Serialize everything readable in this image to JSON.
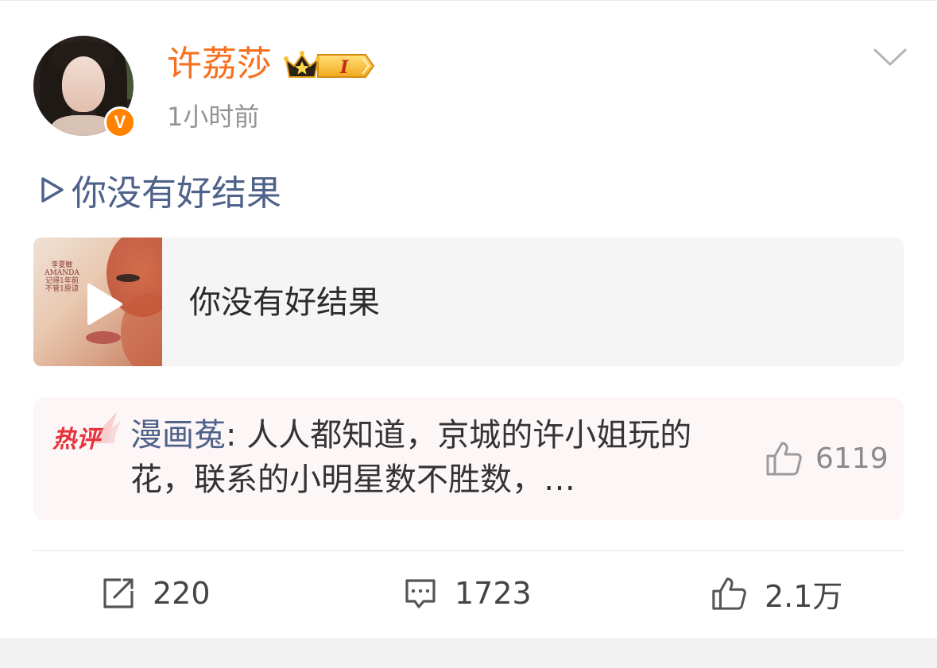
{
  "post": {
    "author": {
      "name": "许荔莎",
      "verified_badge": "V",
      "member_level": "I"
    },
    "timestamp": "1小时前",
    "body_link": "你没有好结果",
    "music_card": {
      "title": "你没有好结果",
      "cover_text": [
        "李夏敏",
        "AMANDA",
        "记得1年前",
        "不管1原谅"
      ]
    },
    "hot_comment": {
      "tag": "热评",
      "author": "漫画菟",
      "text": ": 人人都知道，京城的许小姐玩的花，联系的小明星数不胜数，…",
      "likes": "6119"
    },
    "actions": {
      "reposts": "220",
      "comments": "1723",
      "likes": "2.1万"
    }
  },
  "colors": {
    "username": "#f86f1f",
    "link": "#4f6289",
    "hot_tag": "#e6313b",
    "verified": "#ff8200"
  },
  "icons": [
    "verified-v-icon",
    "crown-level-icon",
    "chevron-down-icon",
    "play-triangle-icon",
    "play-button-icon",
    "hot-comment-flame-icon",
    "thumbs-up-icon",
    "repost-icon",
    "comment-icon"
  ]
}
